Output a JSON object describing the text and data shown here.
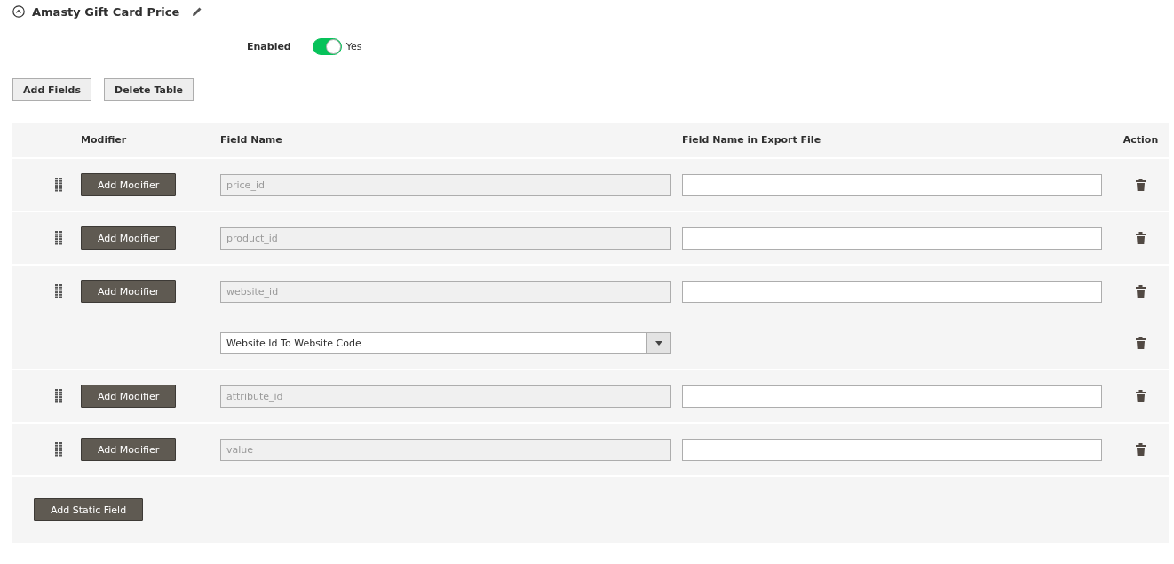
{
  "section": {
    "title": "Amasty Gift Card Price",
    "expanded": true
  },
  "enabled": {
    "label": "Enabled",
    "on": true,
    "value_label": "Yes"
  },
  "buttons": [
    "Add Fields",
    "Delete Table"
  ],
  "table": {
    "columns": [
      "Modifier",
      "Field Name",
      "Field Name in Export File",
      "Action"
    ],
    "rows": [
      {
        "modifier_button": "Add Modifier",
        "field_name": "price_id",
        "export_name": ""
      },
      {
        "modifier_button": "Add Modifier",
        "field_name": "product_id",
        "export_name": ""
      },
      {
        "modifier_button": "Add Modifier",
        "field_name": "website_id",
        "export_name": "",
        "modifiers": [
          {
            "value": "Website Id To Website Code"
          }
        ]
      },
      {
        "modifier_button": "Add Modifier",
        "field_name": "attribute_id",
        "export_name": ""
      },
      {
        "modifier_button": "Add Modifier",
        "field_name": "value",
        "export_name": ""
      }
    ],
    "footer_button": "Add Static Field"
  }
}
